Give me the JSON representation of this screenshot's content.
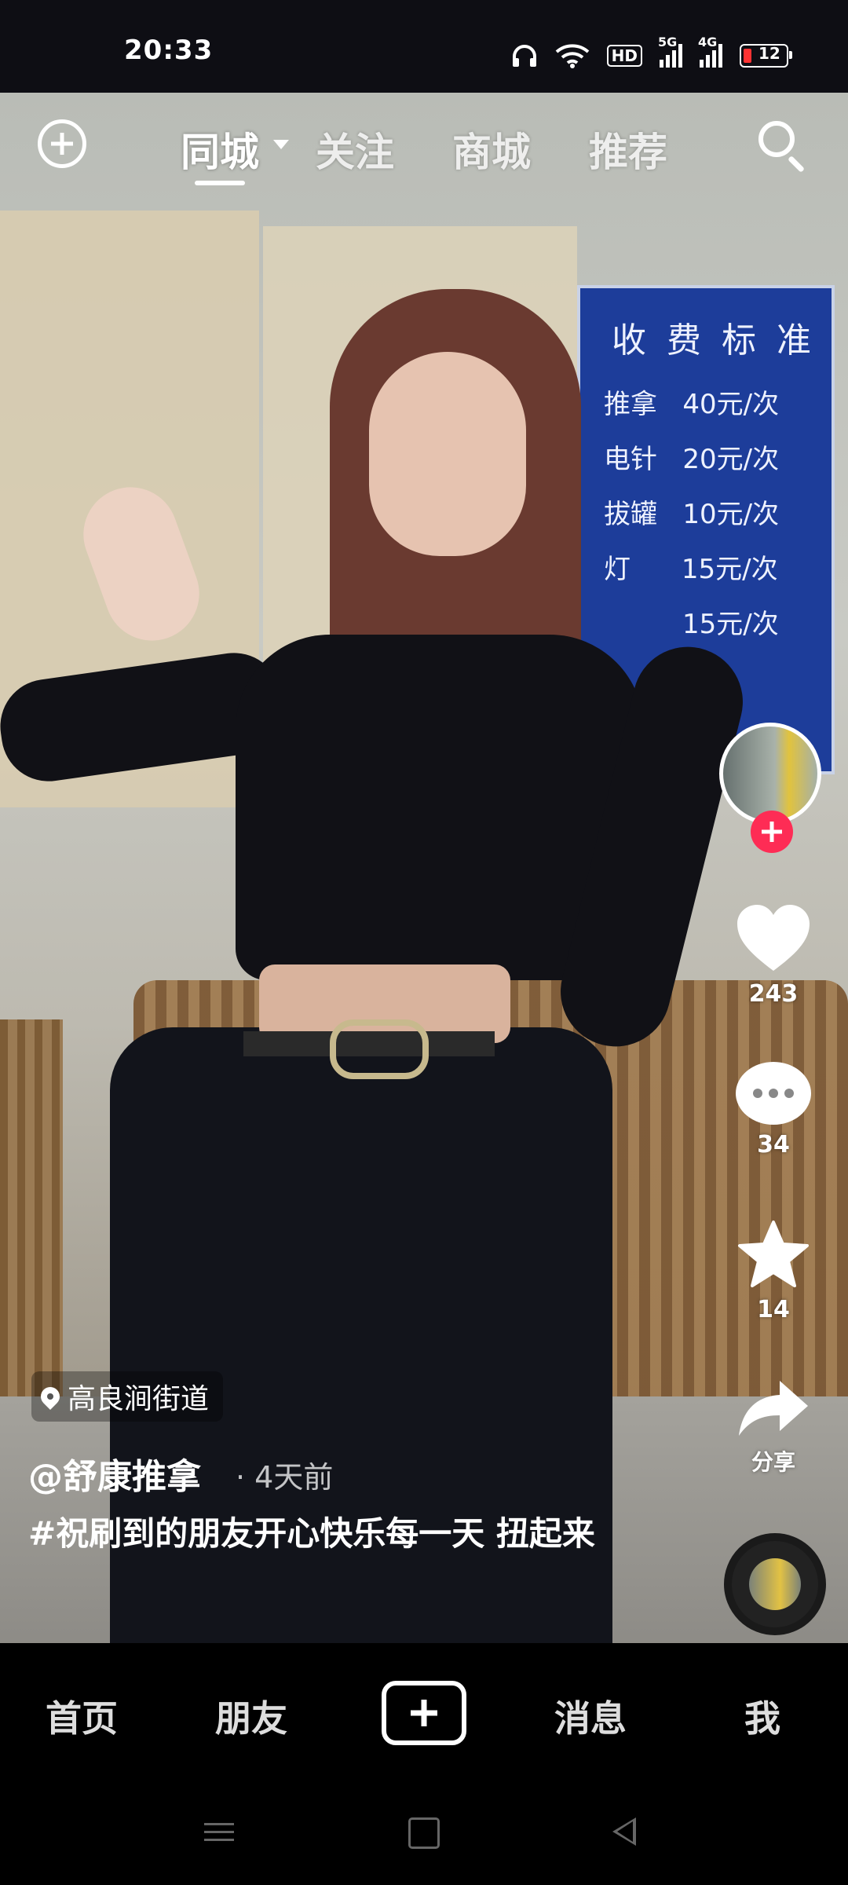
{
  "status_bar": {
    "time": "20:33",
    "battery": "12"
  },
  "top_nav": {
    "tabs": [
      "同城",
      "关注",
      "商城",
      "推荐"
    ],
    "active_tab": "同城"
  },
  "video": {
    "location": "高良涧街道",
    "author": "@舒康推拿",
    "time_ago": "· 4天前",
    "description": "#祝刷到的朋友开心快乐每一天 扭起来"
  },
  "actions": {
    "likes": "243",
    "comments": "34",
    "favorites": "14",
    "share_label": "分享"
  },
  "bottom_nav": {
    "home": "首页",
    "friends": "朋友",
    "messages": "消息",
    "me": "我"
  },
  "icons": [
    "plus-icon",
    "dropdown-icon",
    "search-icon",
    "heart-icon",
    "comment-icon",
    "star-icon",
    "share-icon",
    "location-pin-icon",
    "create-icon",
    "headphones-icon",
    "wifi-icon",
    "battery-icon"
  ],
  "colors": {
    "accent": "#fe2c55",
    "nav_bg": "#000000",
    "sign_blue": "#1d3d9a"
  }
}
